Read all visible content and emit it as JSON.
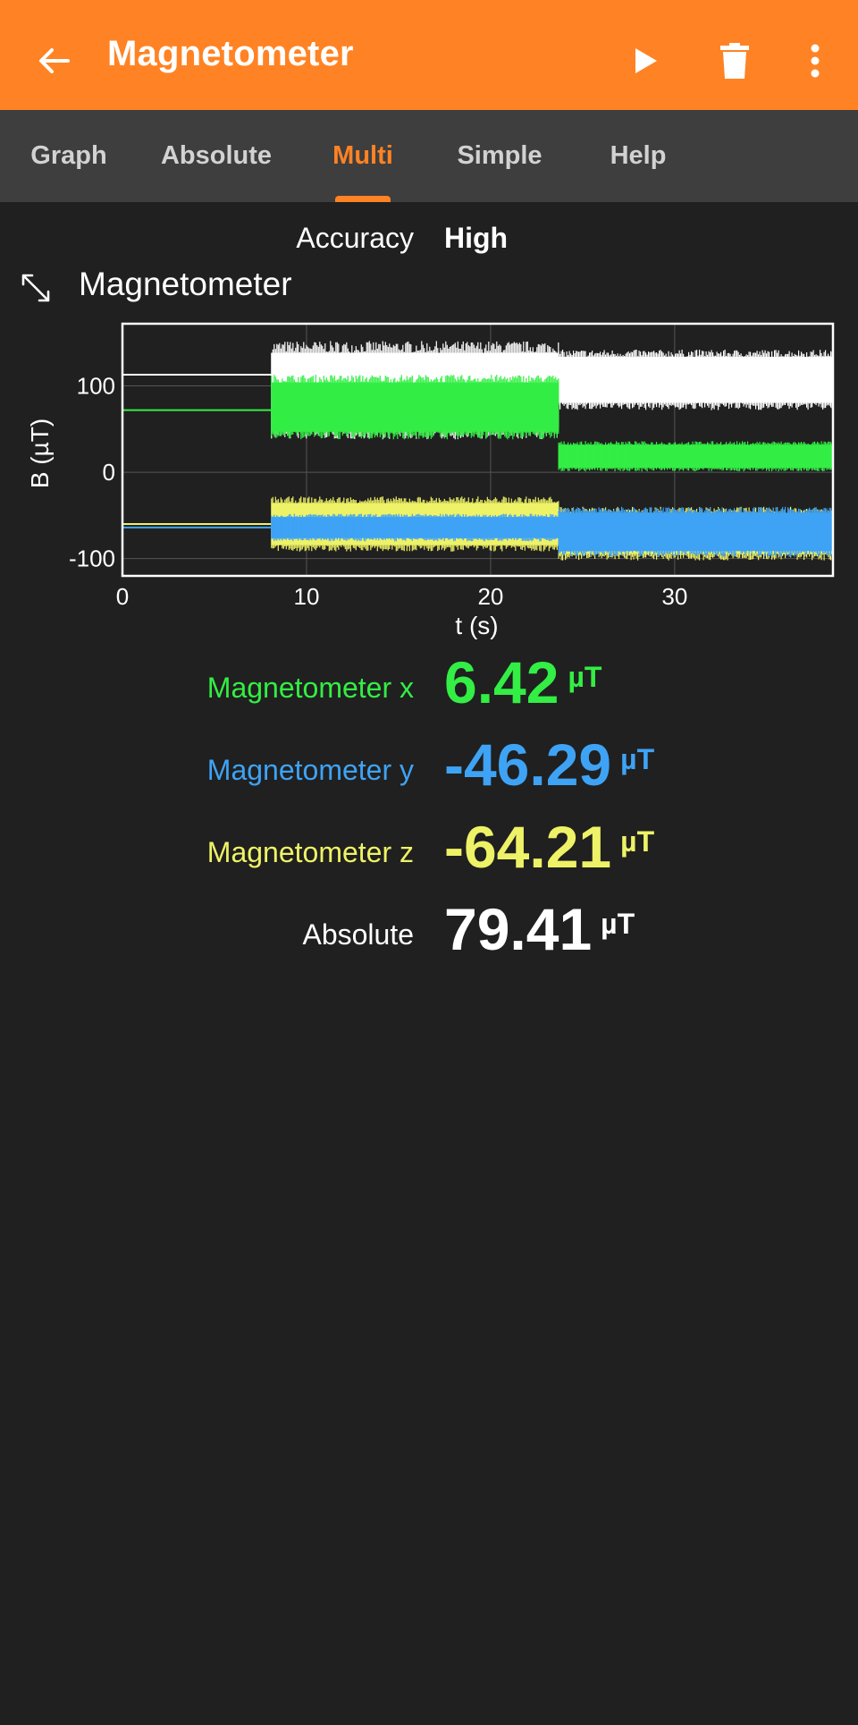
{
  "appbar": {
    "title": "Magnetometer",
    "icons": {
      "back": "arrow-left-icon",
      "play": "play-icon",
      "delete": "trash-icon",
      "more": "more-vertical-icon"
    }
  },
  "tabs": [
    {
      "label": "Graph",
      "active": false
    },
    {
      "label": "Absolute",
      "active": false
    },
    {
      "label": "Multi",
      "active": true
    },
    {
      "label": "Simple",
      "active": false
    },
    {
      "label": "Help",
      "active": false
    }
  ],
  "accuracy": {
    "label": "Accuracy",
    "value": "High"
  },
  "graph": {
    "title": "Magnetometer",
    "expand_icon": "expand-icon"
  },
  "chart_data": {
    "type": "line",
    "xlabel": "t (s)",
    "ylabel": "B (µT)",
    "xlim": [
      0,
      38.6
    ],
    "ylim": [
      -120,
      172
    ],
    "xticks": [
      0,
      10,
      20,
      30
    ],
    "yticks": [
      -100,
      0,
      100
    ],
    "grid": true,
    "series": [
      {
        "id": "abs",
        "color": "#ffffff",
        "segments": [
          {
            "x": [
              0,
              8.1
            ],
            "min": 113,
            "max": 113
          },
          {
            "x": [
              8.1,
              23.7
            ],
            "min": 38,
            "max": 152
          },
          {
            "x": [
              23.7,
              38.6
            ],
            "min": 72,
            "max": 142
          }
        ]
      },
      {
        "id": "x",
        "color": "#33ee44",
        "segments": [
          {
            "x": [
              0,
              8.1
            ],
            "min": 72,
            "max": 72
          },
          {
            "x": [
              8.1,
              23.7
            ],
            "min": 38,
            "max": 113
          },
          {
            "x": [
              23.7,
              38.6
            ],
            "min": 1,
            "max": 36
          }
        ]
      },
      {
        "id": "z",
        "color": "#eef266",
        "segments": [
          {
            "x": [
              0,
              8.1
            ],
            "min": -60,
            "max": -60
          },
          {
            "x": [
              8.1,
              23.7
            ],
            "min": -92,
            "max": -28
          },
          {
            "x": [
              23.7,
              38.6
            ],
            "min": -102,
            "max": -40
          }
        ]
      },
      {
        "id": "y",
        "color": "#3ea3f5",
        "segments": [
          {
            "x": [
              0,
              8.1
            ],
            "min": -64,
            "max": -64
          },
          {
            "x": [
              8.1,
              23.7
            ],
            "min": -80,
            "max": -48
          },
          {
            "x": [
              23.7,
              38.6
            ],
            "min": -98,
            "max": -40
          }
        ]
      }
    ]
  },
  "readings": [
    {
      "label": "Magnetometer x",
      "value": "6.42",
      "unit": "µT",
      "color": "#33ee44"
    },
    {
      "label": "Magnetometer y",
      "value": "-46.29",
      "unit": "µT",
      "color": "#3ea3f5"
    },
    {
      "label": "Magnetometer z",
      "value": "-64.21",
      "unit": "µT",
      "color": "#eef266"
    },
    {
      "label": "Absolute",
      "value": "79.41",
      "unit": "µT",
      "color": "#ffffff"
    }
  ],
  "colors": {
    "accent": "#ff8324",
    "tabbar": "#3e3e3e",
    "background": "#202020"
  }
}
